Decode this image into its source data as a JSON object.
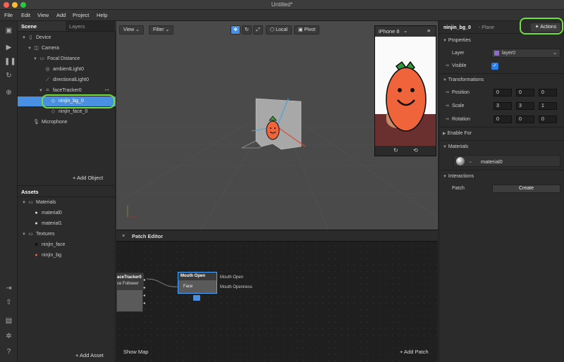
{
  "window": {
    "title": "Untitled*"
  },
  "menu": [
    "File",
    "Edit",
    "View",
    "Add",
    "Project",
    "Help"
  ],
  "scene": {
    "tabs": [
      "Scene",
      "Layers"
    ],
    "items": [
      {
        "label": "Device"
      },
      {
        "label": "Camera"
      },
      {
        "label": "Focal Distance"
      },
      {
        "label": "ambientLight0"
      },
      {
        "label": "directionalLight0"
      },
      {
        "label": "faceTracker0"
      },
      {
        "label": "ninjin_bg_0"
      },
      {
        "label": "ninjin_face_0"
      },
      {
        "label": "Microphone"
      }
    ],
    "add_object": "+ Add Object"
  },
  "assets": {
    "title": "Assets",
    "materials_label": "Materials",
    "materials": [
      "material0",
      "material1"
    ],
    "textures_label": "Textures",
    "textures": [
      "ninjin_face",
      "ninjin_bg"
    ],
    "add_asset": "+ Add Asset"
  },
  "viewport": {
    "view": "View",
    "filter": "Filter",
    "local": "Local",
    "pivot": "Pivot",
    "device": "iPhone 8"
  },
  "patch_editor": {
    "title": "Patch Editor",
    "close": "×",
    "show_map": "Show Map",
    "add_patch": "+ Add Patch",
    "node_left_title": "aceTracker0",
    "node_left_sub": "ce Follower",
    "node_mouth_title": "Mouth Open",
    "node_mouth_port": "Face",
    "out_1": "Mouth Open",
    "out_2": "Mouth Openness"
  },
  "inspector": {
    "object_name": "ninjin_bg_0",
    "object_type": "- Plane",
    "actions": "Actions",
    "properties": "Properties",
    "layer_label": "Layer",
    "layer_value": "layer0",
    "visible_label": "Visible",
    "visible_check": "✓",
    "transformations": "Transformations",
    "position_label": "Position",
    "position": [
      "0",
      "0",
      "0"
    ],
    "scale_label": "Scale",
    "scale": [
      "3",
      "3",
      "1"
    ],
    "rotation_label": "Rotation",
    "rotation": [
      "0",
      "0",
      "0"
    ],
    "enable_for": "Enable For",
    "materials": "Materials",
    "material_value": "material0",
    "interactions": "Interactions",
    "patch_label": "Patch",
    "create": "Create"
  },
  "colors": {
    "selection": "#4a90e2",
    "highlight": "#6fe03a",
    "carrot": "#f0643c"
  }
}
